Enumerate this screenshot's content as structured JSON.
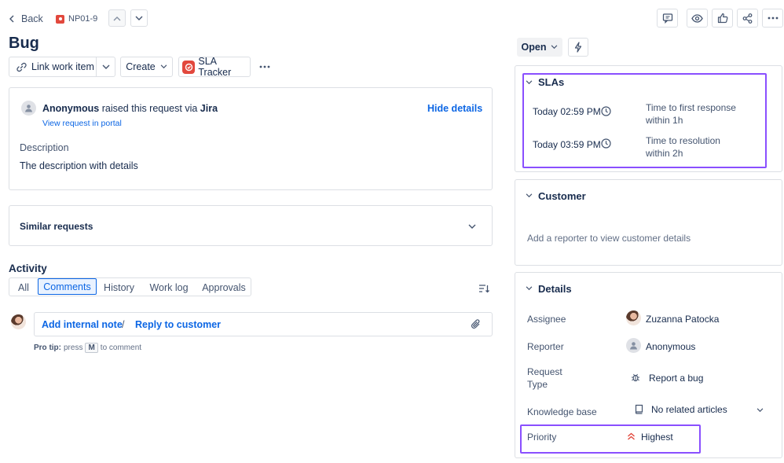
{
  "header": {
    "back_label": "Back",
    "issue_key": "NP01-9",
    "title": "Bug"
  },
  "toolbar": {
    "link_work_item": "Link work item",
    "create": "Create",
    "sla_tracker": "SLA Tracker"
  },
  "request": {
    "author": "Anonymous",
    "raised_text": "raised this request via",
    "channel": "Jira",
    "view_in_portal": "View request in portal",
    "hide_details": "Hide details",
    "description_label": "Description",
    "description": "The description with details"
  },
  "similar_requests": {
    "label": "Similar requests"
  },
  "activity": {
    "title": "Activity",
    "tabs": [
      "All",
      "Comments",
      "History",
      "Work log",
      "Approvals"
    ],
    "active_tab": "Comments",
    "add_internal_note": "Add internal note",
    "separator": "/",
    "reply_to_customer": "Reply to customer",
    "pro_tip_label": "Pro tip:",
    "pro_tip_press": "press",
    "pro_tip_key": "M",
    "pro_tip_suffix": "to comment"
  },
  "status": {
    "label": "Open"
  },
  "slas": {
    "title": "SLAs",
    "items": [
      {
        "time": "Today 02:59 PM",
        "line1": "Time to first response",
        "line2": "within 1h"
      },
      {
        "time": "Today 03:59 PM",
        "line1": "Time to resolution",
        "line2": "within 2h"
      }
    ]
  },
  "customer": {
    "title": "Customer",
    "empty": "Add a reporter to view customer details"
  },
  "details": {
    "title": "Details",
    "assignee_label": "Assignee",
    "assignee_value": "Zuzanna Patocka",
    "reporter_label": "Reporter",
    "reporter_value": "Anonymous",
    "request_type_label_1": "Request",
    "request_type_label_2": "Type",
    "request_type_value": "Report a bug",
    "kb_label": "Knowledge base",
    "kb_value": "No related articles",
    "priority_label": "Priority",
    "priority_value": "Highest"
  },
  "colors": {
    "link": "#0c66e4",
    "highlight": "#8a4fff",
    "priority": "#e2483d",
    "issue_icon": "#e2483d"
  }
}
